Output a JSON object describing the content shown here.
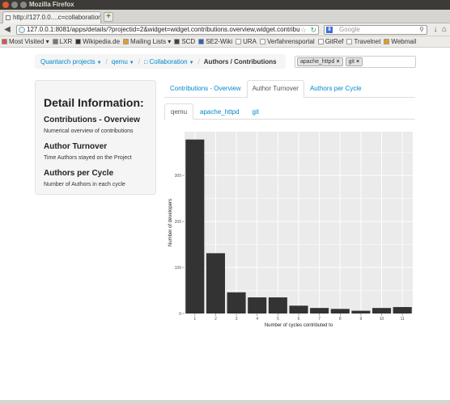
{
  "window": {
    "title": "Mozilla Firefox",
    "tab_title": "http://127.0.0....c=collaboration",
    "url": "127.0.0.1:8081/apps/details/?projectid=2&widget=widget.contributions.overview,widget.contribu",
    "search_placeholder": "Google",
    "search_engine_letter": "8"
  },
  "bookmarks": [
    {
      "label": "Most Visited ▾",
      "color": "#d9534f"
    },
    {
      "label": "LXR",
      "color": "#777777"
    },
    {
      "label": "Wikipedia.de",
      "color": "#333333"
    },
    {
      "label": "Mailing Lists ▾",
      "color": "#e0a030"
    },
    {
      "label": "SCD",
      "color": "#444444"
    },
    {
      "label": "SE2-Wiki",
      "color": "#2e63b8"
    },
    {
      "label": "URA",
      "color": "#ffffff"
    },
    {
      "label": "Verfahrensportal",
      "color": "#ffffff"
    },
    {
      "label": "GitRef",
      "color": "#ffffff"
    },
    {
      "label": "Travelnet",
      "color": "#ffffff"
    },
    {
      "label": "Webmail",
      "color": "#e89a1e"
    }
  ],
  "breadcrumb": {
    "items": [
      "Quantarch projects",
      "qemu",
      "Collaboration"
    ],
    "current": "Authors / Contributions",
    "separator": "/"
  },
  "tags": [
    "apache_httpd",
    "git"
  ],
  "detail": {
    "heading": "Detail Information:",
    "sections": [
      {
        "title": "Contributions - Overview",
        "text": "Numerical overview of contributions"
      },
      {
        "title": "Author Turnover",
        "text": "Time Authors stayed on the Project"
      },
      {
        "title": "Authors per Cycle",
        "text": "Number of Authors in each cycle"
      }
    ]
  },
  "main_tabs": [
    {
      "label": "Contributions - Overview",
      "active": false
    },
    {
      "label": "Author Turnover",
      "active": true
    },
    {
      "label": "Authors per Cycle",
      "active": false
    }
  ],
  "sub_tabs": [
    {
      "label": "qemu",
      "active": true
    },
    {
      "label": "apache_httpd",
      "active": false
    },
    {
      "label": "git",
      "active": false
    }
  ],
  "chart_data": {
    "type": "bar",
    "categories": [
      "1",
      "2",
      "3",
      "4",
      "5",
      "6",
      "7",
      "8",
      "9",
      "10",
      "11"
    ],
    "values": [
      378,
      131,
      46,
      35,
      35,
      17,
      12,
      10,
      6,
      12,
      14
    ],
    "xlabel": "Number of cycles contributed to",
    "ylabel": "Number of developers",
    "ylim": [
      0,
      395
    ],
    "yticks": [
      0,
      100,
      200,
      300
    ],
    "grid": true,
    "bar_color": "#333333",
    "panel_color": "#ebebeb"
  }
}
